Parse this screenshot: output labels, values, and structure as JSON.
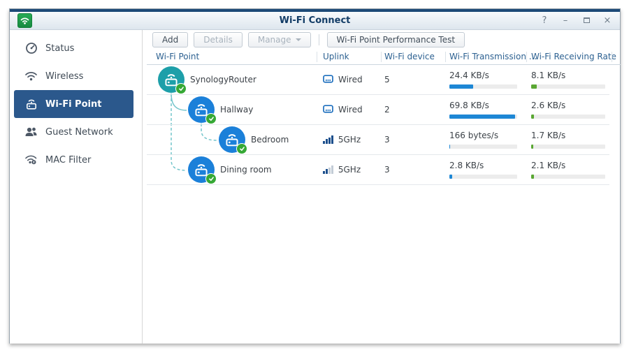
{
  "window": {
    "title": "Wi-Fi Connect",
    "controls": [
      {
        "name": "help",
        "glyph": "?"
      },
      {
        "name": "minimize",
        "glyph": "–"
      },
      {
        "name": "maximize",
        "glyph": ""
      },
      {
        "name": "close",
        "glyph": "×"
      }
    ]
  },
  "sidebar": {
    "items": [
      {
        "label": "Status",
        "icon": "gauge-icon",
        "selected": false
      },
      {
        "label": "Wireless",
        "icon": "wifi-icon",
        "selected": false
      },
      {
        "label": "Wi-Fi Point",
        "icon": "wifi-point-icon",
        "selected": true
      },
      {
        "label": "Guest Network",
        "icon": "users-icon",
        "selected": false
      },
      {
        "label": "MAC Filter",
        "icon": "wifi-lock-icon",
        "selected": false
      }
    ]
  },
  "toolbar": {
    "buttons": [
      {
        "label": "Add",
        "enabled": true,
        "has_caret": false
      },
      {
        "label": "Details",
        "enabled": false,
        "has_caret": false
      },
      {
        "label": "Manage",
        "enabled": false,
        "has_caret": true
      },
      {
        "label": "Wi-Fi Point Performance Test",
        "enabled": true,
        "has_caret": false
      }
    ]
  },
  "table": {
    "columns": [
      "Wi-Fi Point",
      "Uplink",
      "Wi-Fi device",
      "Wi-Fi Transmission ...",
      "Wi-Fi Receiving Rate"
    ],
    "rows": [
      {
        "name": "SynologyRouter",
        "level": 0,
        "node_color": "#1d9fa9",
        "uplink_type": "wired",
        "uplink": "Wired",
        "signal_bars": 0,
        "devices": "5",
        "tx_rate": "24.4 KB/s",
        "tx_pct": 35,
        "rx_rate": "8.1 KB/s",
        "rx_pct": 8
      },
      {
        "name": "Hallway",
        "level": 1,
        "node_color": "#1b80d9",
        "uplink_type": "wired",
        "uplink": "Wired",
        "signal_bars": 0,
        "devices": "2",
        "tx_rate": "69.8 KB/s",
        "tx_pct": 97,
        "rx_rate": "2.6 KB/s",
        "rx_pct": 4
      },
      {
        "name": "Bedroom",
        "level": 2,
        "node_color": "#1b80d9",
        "uplink_type": "wifi",
        "uplink": "5GHz",
        "signal_bars": 4,
        "devices": "3",
        "tx_rate": "166 bytes/s",
        "tx_pct": 1,
        "rx_rate": "1.7 KB/s",
        "rx_pct": 3
      },
      {
        "name": "Dining room",
        "level": 1,
        "node_color": "#1b80d9",
        "uplink_type": "wifi",
        "uplink": "5GHz",
        "signal_bars": 2,
        "devices": "3",
        "tx_rate": "2.8 KB/s",
        "tx_pct": 4,
        "rx_rate": "2.1 KB/s",
        "rx_pct": 4
      }
    ]
  },
  "colors": {
    "accent_blue": "#1e87d5",
    "accent_green": "#5aa733",
    "node_teal": "#1d9fa9",
    "node_blue": "#1b80d9",
    "selected_nav": "#2b588c",
    "badge_green": "#36a835",
    "titlebar_border_top": "#1d4a77"
  }
}
